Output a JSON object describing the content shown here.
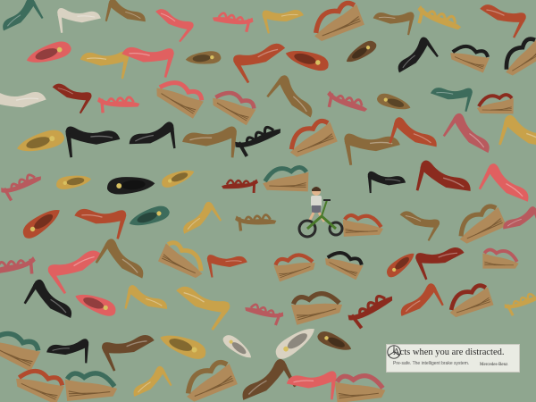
{
  "ad": {
    "headline": "Acts when you are distracted.",
    "subline": "Pre-safe. The intelligent brake system.",
    "brand": "Mercedes-Benz",
    "logo_icon": "mercedes-star-icon",
    "background_color": "#8fa68f"
  },
  "scene": {
    "pattern": "assorted women's shoes on green background",
    "shoe_colors": [
      "#1d1d1d",
      "#8b2b1e",
      "#b24b2e",
      "#c9a24a",
      "#8a6a3c",
      "#3d6c5c",
      "#d9d2c2",
      "#b85a5e",
      "#6b4a2c",
      "#e06060"
    ],
    "hidden_figure": "child-on-tricycle"
  }
}
